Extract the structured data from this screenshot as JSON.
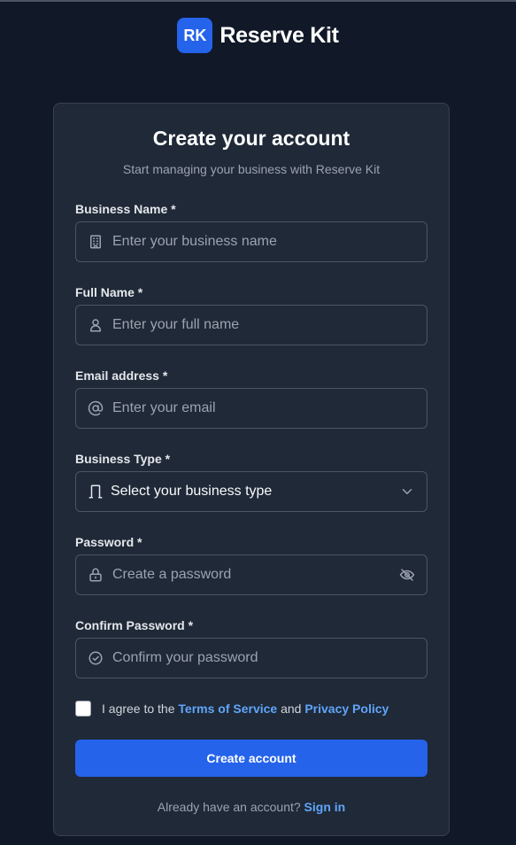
{
  "brand": {
    "logo_text": "RK",
    "name": "Reserve Kit"
  },
  "form": {
    "title": "Create your account",
    "subtitle": "Start managing your business with Reserve Kit",
    "fields": {
      "business_name": {
        "label": "Business Name *",
        "placeholder": "Enter your business name",
        "icon": "building-icon"
      },
      "full_name": {
        "label": "Full Name *",
        "placeholder": "Enter your full name",
        "icon": "user-icon"
      },
      "email": {
        "label": "Email address *",
        "placeholder": "Enter your email",
        "icon": "at-sign-icon"
      },
      "business_type": {
        "label": "Business Type *",
        "value": "Select your business type",
        "icon": "door-icon"
      },
      "password": {
        "label": "Password *",
        "placeholder": "Create a password",
        "icon": "lock-icon"
      },
      "confirm_password": {
        "label": "Confirm Password *",
        "placeholder": "Confirm your password",
        "icon": "check-circle-icon"
      }
    },
    "agree": {
      "prefix": "I agree to the",
      "terms": "Terms of Service",
      "and": "and",
      "privacy": "Privacy Policy"
    },
    "submit_label": "Create account",
    "signin": {
      "prompt": "Already have an account?",
      "link": "Sign in"
    }
  },
  "colors": {
    "background": "#111827",
    "card": "#1f2937",
    "accent": "#2563eb",
    "link": "#60a5fa"
  }
}
